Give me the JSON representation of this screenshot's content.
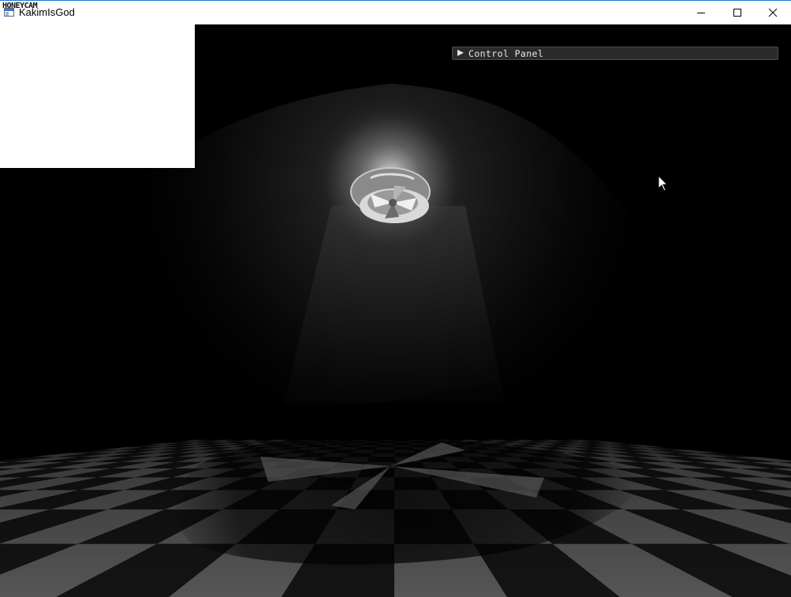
{
  "window": {
    "title": "KakimIsGod",
    "watermark": "HONEYCAM",
    "buttons": {
      "minimize": "minimize",
      "maximize": "maximize",
      "close": "close"
    }
  },
  "overlay": {
    "control_panel": {
      "label": "Control Panel",
      "collapsed": true,
      "arrow_icon": "triangle-right-icon"
    }
  },
  "scene": {
    "floor": "checkerboard",
    "light": "ceiling-fan-lamp",
    "colors": {
      "light_checker": "#5a5a5a",
      "dark_checker": "#151515"
    }
  }
}
